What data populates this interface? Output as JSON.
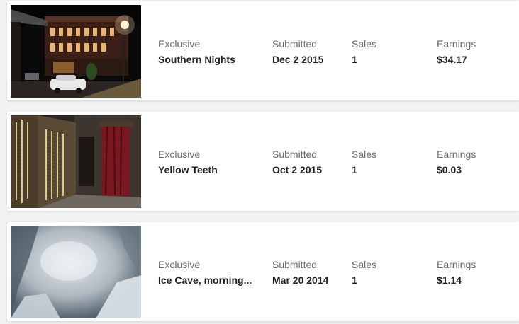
{
  "columns": {
    "status": "Exclusive",
    "submitted": "Submitted",
    "sales": "Sales",
    "earnings": "Earnings"
  },
  "items": [
    {
      "title": "Southern Nights",
      "submitted": "Dec 2 2015",
      "sales": "1",
      "earnings": "$34.17",
      "thumbnail": "night-street-photo"
    },
    {
      "title": "Yellow Teeth",
      "submitted": "Oct 2 2015",
      "sales": "1",
      "earnings": "$0.03",
      "thumbnail": "old-piano-keys-photo"
    },
    {
      "title": "Ice Cave, morning...",
      "submitted": "Mar 20 2014",
      "sales": "1",
      "earnings": "$1.14",
      "thumbnail": "ice-cave-photo"
    }
  ]
}
